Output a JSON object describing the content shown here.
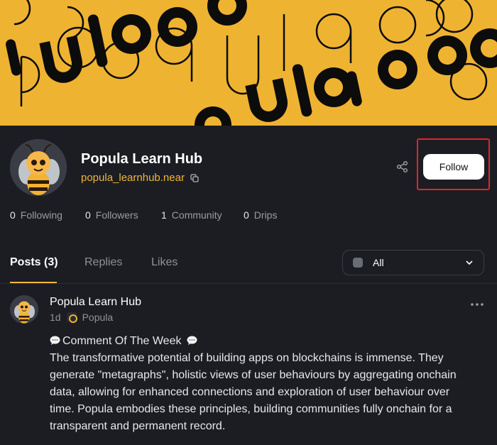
{
  "banner": {
    "bg_color": "#efb332",
    "text_color": "#0c0c0c"
  },
  "profile": {
    "name": "Popula Learn Hub",
    "handle": "popula_learnhub.near",
    "follow_label": "Follow",
    "stats": [
      {
        "value": "0",
        "label": "Following"
      },
      {
        "value": "0",
        "label": "Followers"
      },
      {
        "value": "1",
        "label": "Community"
      },
      {
        "value": "0",
        "label": "Drips"
      }
    ]
  },
  "tabs": [
    {
      "label": "Posts (3)",
      "active": true
    },
    {
      "label": "Replies",
      "active": false
    },
    {
      "label": "Likes",
      "active": false
    }
  ],
  "filter": {
    "selected": "All"
  },
  "post": {
    "author": "Popula Learn Hub",
    "time": "1d",
    "community": "Popula",
    "title": "Comment Of The Week",
    "lines": [
      "The transformative potential of building apps on blockchains is immense. They",
      "generate \"metagraphs\", holistic views of user behaviours by aggregating onchain",
      "data, allowing for enhanced connections and exploration of user behaviour over",
      "time. Popula embodies these principles, building communities fully onchain for a",
      "transparent and permanent record."
    ]
  },
  "colors": {
    "accent": "#f0b53a",
    "highlight": "#e0252b",
    "background": "#1c1d22"
  }
}
